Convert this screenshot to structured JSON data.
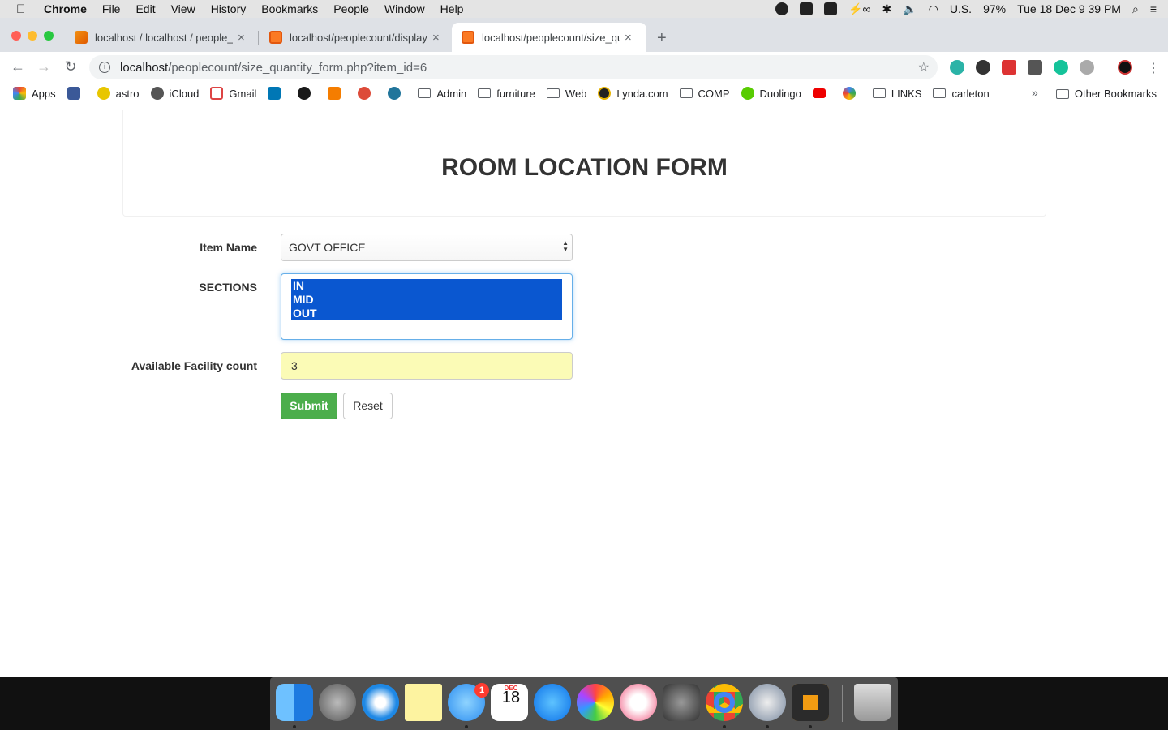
{
  "menubar": {
    "app_name": "Chrome",
    "items": [
      "File",
      "Edit",
      "View",
      "History",
      "Bookmarks",
      "People",
      "Window",
      "Help"
    ],
    "input_source": "U.S.",
    "battery": "97%",
    "clock": "Tue 18 Dec  9 39 PM"
  },
  "tabs": [
    {
      "title": "localhost / localhost / people_c",
      "favicon": "phpmyadmin-icon"
    },
    {
      "title": "localhost/peoplecount/display_",
      "favicon": "xampp-icon"
    },
    {
      "title": "localhost/peoplecount/size_qu",
      "favicon": "xampp-icon"
    }
  ],
  "tab_close_glyph": "×",
  "new_tab_glyph": "+",
  "address_bar": {
    "host": "localhost",
    "path": "/peoplecount/size_quantity_form.php?item_id=6"
  },
  "bookmarks": {
    "items": [
      "Apps",
      "",
      "astro",
      "iCloud",
      "Gmail",
      "",
      "",
      "",
      "",
      "",
      "Admin",
      "furniture",
      "Web",
      "Lynda.com",
      "COMP",
      "Duolingo",
      "",
      "",
      "LINKS",
      "carleton"
    ],
    "more_glyph": "»",
    "other": "Other Bookmarks"
  },
  "page": {
    "title": "ROOM LOCATION FORM",
    "form": {
      "item_name_label": "Item Name",
      "item_name_value": "GOVT OFFICE",
      "sections_label": "SECTIONS",
      "sections_options": [
        "IN",
        "MID",
        "OUT"
      ],
      "facility_count_label": "Available Facility count",
      "facility_count_value": "3",
      "submit_label": "Submit",
      "reset_label": "Reset"
    }
  },
  "dock": {
    "messages_badge": "1",
    "calendar_month": "DEC",
    "calendar_day": "18"
  },
  "colors": {
    "submit_bg": "#4cae4c",
    "list_selected_bg": "#0a57d0",
    "count_field_bg": "#fbfbb6"
  }
}
